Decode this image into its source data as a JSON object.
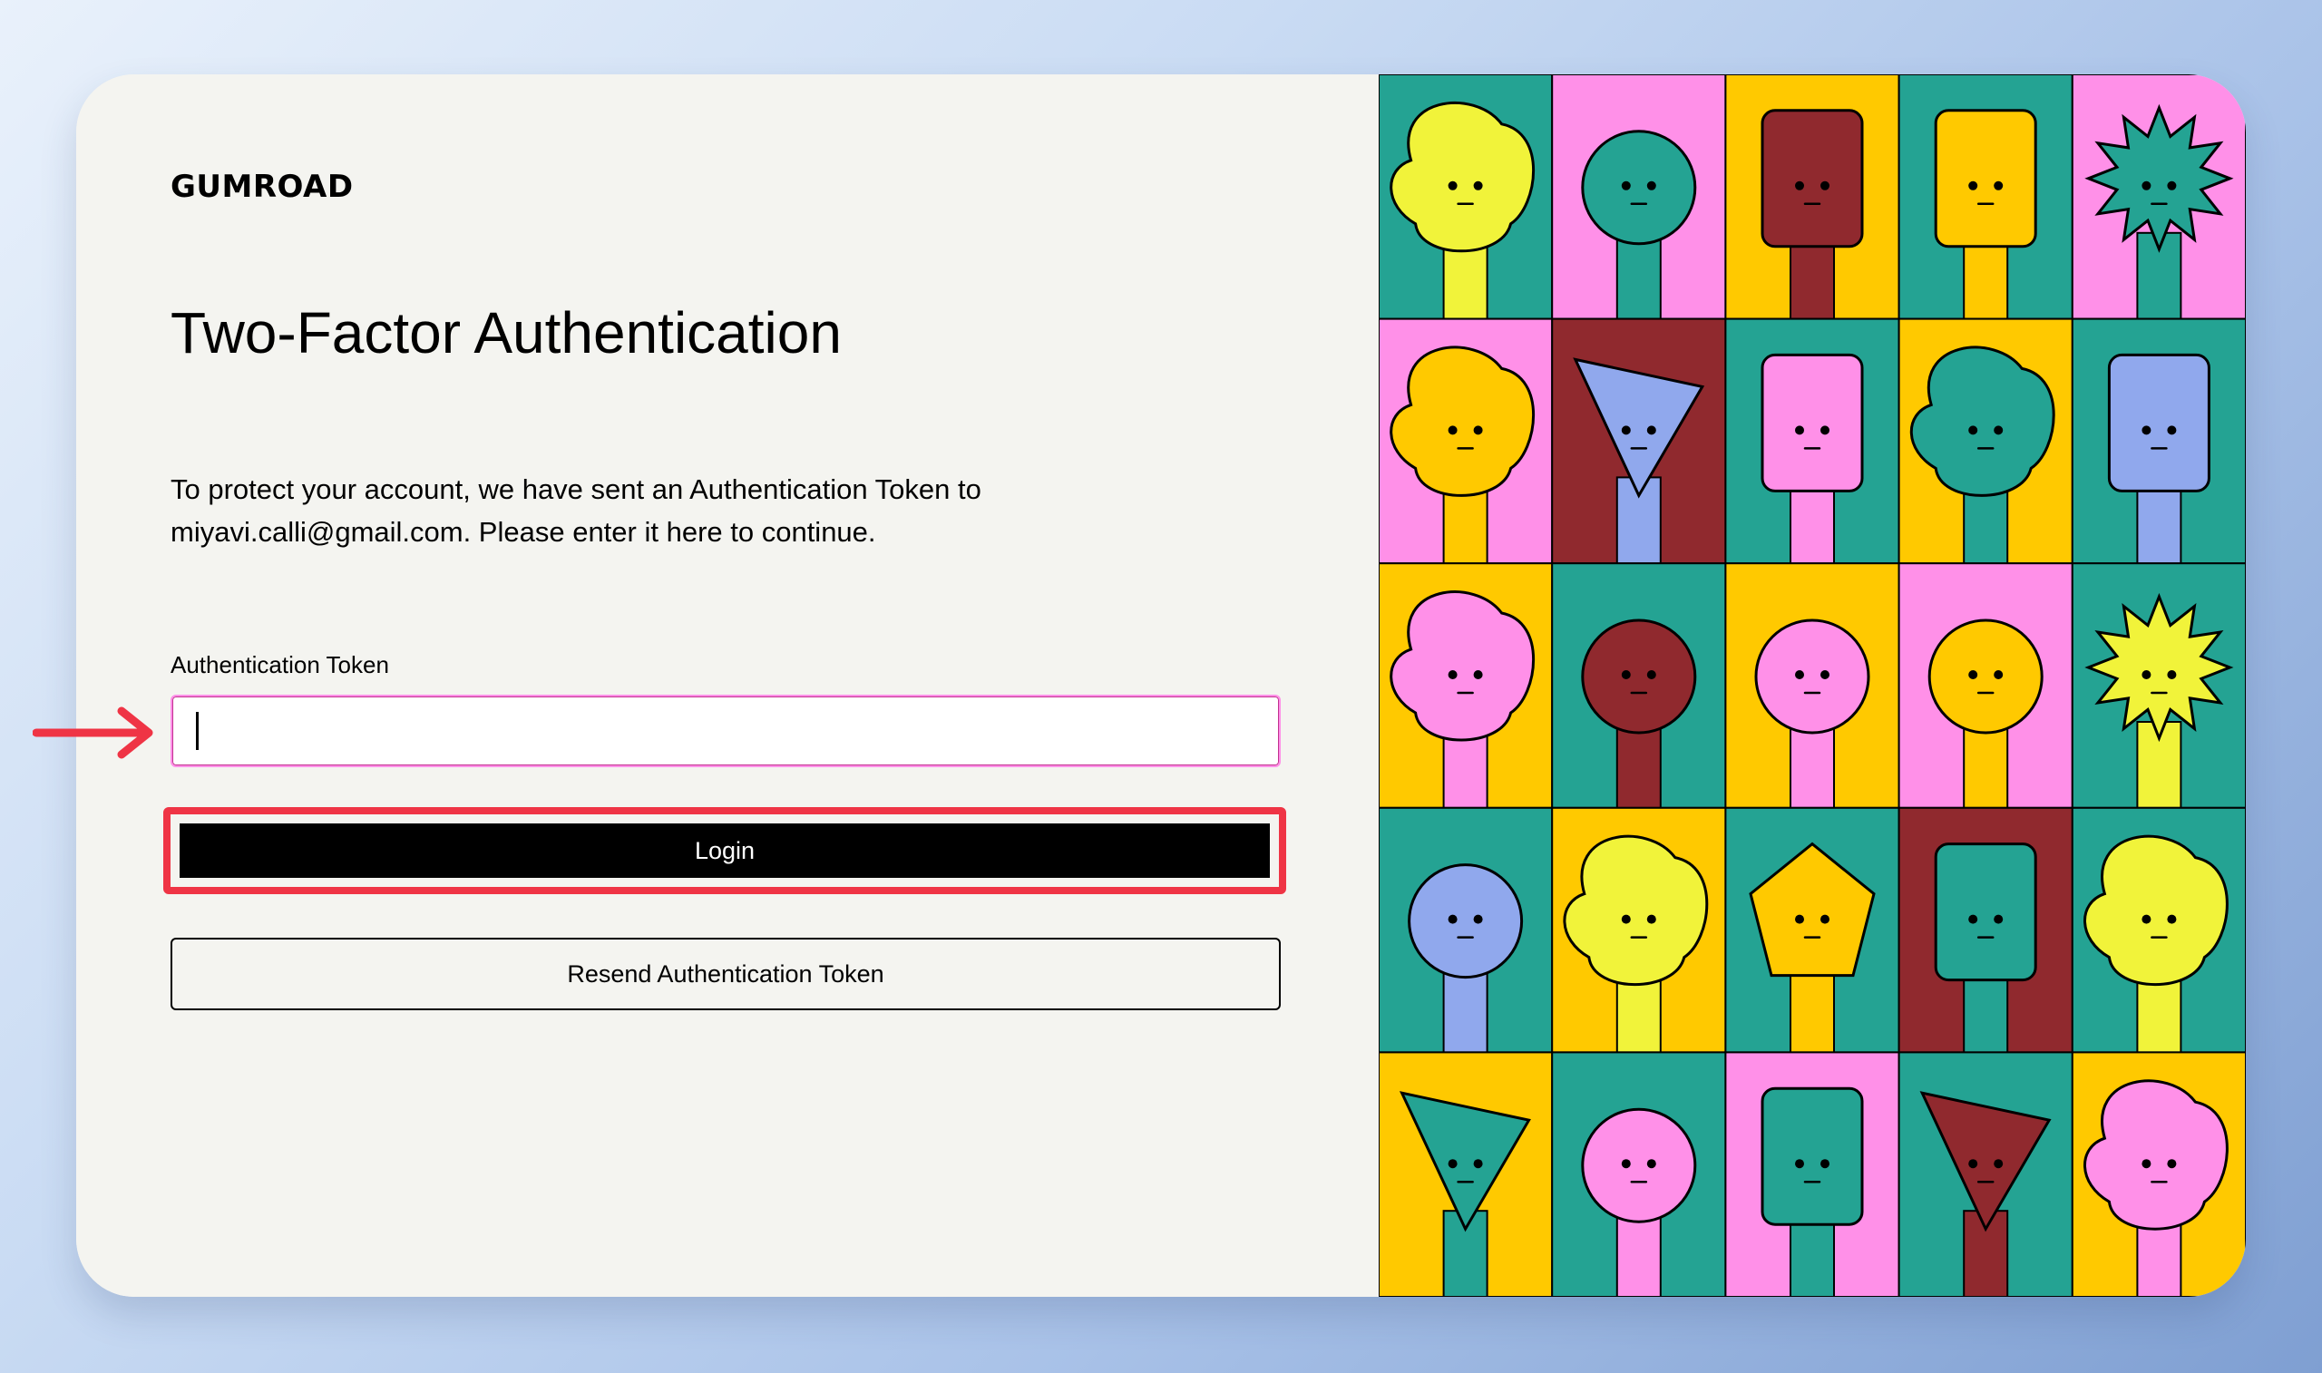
{
  "brand": {
    "logo_text": "GUMROAD"
  },
  "page": {
    "title": "Two-Factor Authentication",
    "description": "To protect your account, we have sent an Authentication Token to miyavi.calli@gmail.com. Please enter it here to continue."
  },
  "form": {
    "token_label": "Authentication Token",
    "token_value": "",
    "login_label": "Login",
    "resend_label": "Resend Authentication Token"
  },
  "colors": {
    "background": "#f4f4f0",
    "accent_pink": "#ff90e8",
    "annotation_red": "#ef3445",
    "button_black": "#000000"
  },
  "illustration": {
    "grid_columns": 5,
    "grid_rows": 5,
    "tiles": [
      {
        "bg": "#24a393",
        "fg": "#f1f33a",
        "shape": "blob"
      },
      {
        "bg": "#ff90e8",
        "fg": "#24a393",
        "shape": "circle"
      },
      {
        "bg": "#ffc900",
        "fg": "#90292e",
        "shape": "rect"
      },
      {
        "bg": "#24a393",
        "fg": "#ffc900",
        "shape": "rect"
      },
      {
        "bg": "#ff90e8",
        "fg": "#24a393",
        "shape": "star"
      },
      {
        "bg": "#ff90e8",
        "fg": "#ffc900",
        "shape": "blob"
      },
      {
        "bg": "#90292e",
        "fg": "#90a8ed",
        "shape": "triangle"
      },
      {
        "bg": "#24a393",
        "fg": "#ff90e8",
        "shape": "rect"
      },
      {
        "bg": "#ffc900",
        "fg": "#24a393",
        "shape": "blob"
      },
      {
        "bg": "#24a393",
        "fg": "#90a8ed",
        "shape": "rect"
      },
      {
        "bg": "#ffc900",
        "fg": "#ff90e8",
        "shape": "blob"
      },
      {
        "bg": "#24a393",
        "fg": "#90292e",
        "shape": "circle"
      },
      {
        "bg": "#ffc900",
        "fg": "#ff90e8",
        "shape": "circle"
      },
      {
        "bg": "#ff90e8",
        "fg": "#ffc900",
        "shape": "circle"
      },
      {
        "bg": "#24a393",
        "fg": "#f1f33a",
        "shape": "star"
      },
      {
        "bg": "#24a393",
        "fg": "#90a8ed",
        "shape": "circle"
      },
      {
        "bg": "#ffc900",
        "fg": "#f1f33a",
        "shape": "blob"
      },
      {
        "bg": "#24a393",
        "fg": "#ffc900",
        "shape": "pentagon"
      },
      {
        "bg": "#90292e",
        "fg": "#24a393",
        "shape": "rect"
      },
      {
        "bg": "#24a393",
        "fg": "#f1f33a",
        "shape": "blob"
      },
      {
        "bg": "#ffc900",
        "fg": "#24a393",
        "shape": "triangle"
      },
      {
        "bg": "#24a393",
        "fg": "#ff90e8",
        "shape": "circle"
      },
      {
        "bg": "#ff90e8",
        "fg": "#24a393",
        "shape": "rect"
      },
      {
        "bg": "#24a393",
        "fg": "#90292e",
        "shape": "triangle"
      },
      {
        "bg": "#ffc900",
        "fg": "#ff90e8",
        "shape": "blob"
      }
    ]
  }
}
